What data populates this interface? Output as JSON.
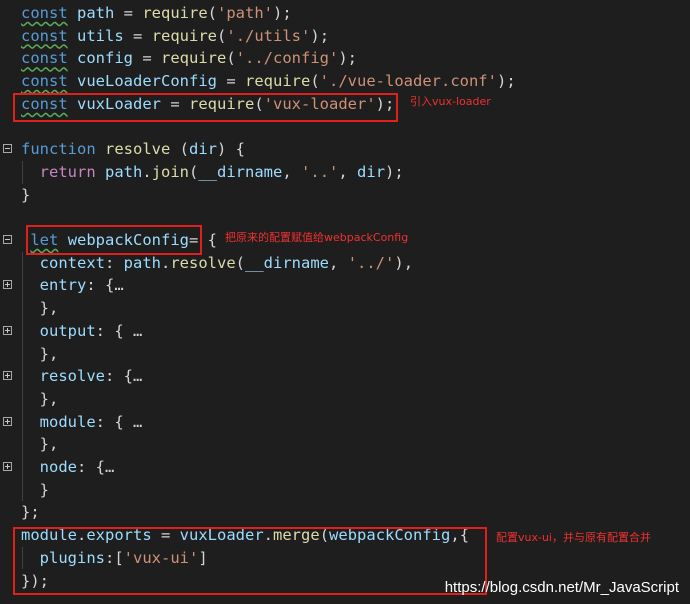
{
  "lines": [
    {
      "tokens": [
        [
          "kw",
          "const"
        ],
        [
          "punc",
          " "
        ],
        [
          "var",
          "path"
        ],
        [
          "punc",
          " = "
        ],
        [
          "fn",
          "require"
        ],
        [
          "punc",
          "("
        ],
        [
          "str",
          "'path'"
        ],
        [
          "punc",
          ");"
        ]
      ]
    },
    {
      "tokens": [
        [
          "kw",
          "const"
        ],
        [
          "punc",
          " "
        ],
        [
          "var",
          "utils"
        ],
        [
          "punc",
          " = "
        ],
        [
          "fn",
          "require"
        ],
        [
          "punc",
          "("
        ],
        [
          "str",
          "'./utils'"
        ],
        [
          "punc",
          ");"
        ]
      ]
    },
    {
      "tokens": [
        [
          "kw",
          "const"
        ],
        [
          "punc",
          " "
        ],
        [
          "var",
          "config"
        ],
        [
          "punc",
          " = "
        ],
        [
          "fn",
          "require"
        ],
        [
          "punc",
          "("
        ],
        [
          "str",
          "'../config'"
        ],
        [
          "punc",
          ");"
        ]
      ]
    },
    {
      "tokens": [
        [
          "kw",
          "const"
        ],
        [
          "punc",
          " "
        ],
        [
          "var",
          "vueLoaderConfig"
        ],
        [
          "punc",
          " = "
        ],
        [
          "fn",
          "require"
        ],
        [
          "punc",
          "("
        ],
        [
          "str",
          "'./vue-loader.conf'"
        ],
        [
          "punc",
          ");"
        ]
      ]
    },
    {
      "tokens": [
        [
          "kw",
          "const"
        ],
        [
          "punc",
          " "
        ],
        [
          "var",
          "vuxLoader"
        ],
        [
          "punc",
          " = "
        ],
        [
          "fn",
          "require"
        ],
        [
          "punc",
          "("
        ],
        [
          "str",
          "'vux-loader'"
        ],
        [
          "punc",
          ");"
        ]
      ]
    },
    {
      "tokens": []
    },
    {
      "tokens": [
        [
          "kw",
          "function"
        ],
        [
          "punc",
          " "
        ],
        [
          "fn",
          "resolve"
        ],
        [
          "punc",
          " ("
        ],
        [
          "var",
          "dir"
        ],
        [
          "punc",
          ") {"
        ]
      ]
    },
    {
      "tokens": [
        [
          "punc",
          "  "
        ],
        [
          "ctl",
          "return"
        ],
        [
          "punc",
          " "
        ],
        [
          "var",
          "path"
        ],
        [
          "punc",
          "."
        ],
        [
          "fn",
          "join"
        ],
        [
          "punc",
          "("
        ],
        [
          "var",
          "__dirname"
        ],
        [
          "punc",
          ", "
        ],
        [
          "str",
          "'..'"
        ],
        [
          "punc",
          ", "
        ],
        [
          "var",
          "dir"
        ],
        [
          "punc",
          ");"
        ]
      ]
    },
    {
      "tokens": [
        [
          "punc",
          "}"
        ]
      ]
    },
    {
      "tokens": []
    },
    {
      "tokens": [
        [
          "punc",
          " "
        ],
        [
          "kw",
          "let"
        ],
        [
          "punc",
          " "
        ],
        [
          "var",
          "webpackConfig"
        ],
        [
          "punc",
          "= {"
        ]
      ]
    },
    {
      "tokens": [
        [
          "punc",
          "  "
        ],
        [
          "var",
          "context"
        ],
        [
          "punc",
          ": "
        ],
        [
          "var",
          "path"
        ],
        [
          "punc",
          "."
        ],
        [
          "fn",
          "resolve"
        ],
        [
          "punc",
          "("
        ],
        [
          "var",
          "__dirname"
        ],
        [
          "punc",
          ", "
        ],
        [
          "str",
          "'../'"
        ],
        [
          "punc",
          "),"
        ]
      ]
    },
    {
      "tokens": [
        [
          "punc",
          "  "
        ],
        [
          "var",
          "entry"
        ],
        [
          "punc",
          ": {"
        ],
        [
          "fold-ell",
          "…"
        ]
      ]
    },
    {
      "tokens": [
        [
          "punc",
          "  },"
        ]
      ]
    },
    {
      "tokens": [
        [
          "punc",
          "  "
        ],
        [
          "var",
          "output"
        ],
        [
          "punc",
          ": {"
        ],
        [
          "fold-ell",
          " …"
        ]
      ]
    },
    {
      "tokens": [
        [
          "punc",
          "  },"
        ]
      ]
    },
    {
      "tokens": [
        [
          "punc",
          "  "
        ],
        [
          "var",
          "resolve"
        ],
        [
          "punc",
          ": {"
        ],
        [
          "fold-ell",
          "…"
        ]
      ]
    },
    {
      "tokens": [
        [
          "punc",
          "  },"
        ]
      ]
    },
    {
      "tokens": [
        [
          "punc",
          "  "
        ],
        [
          "var",
          "module"
        ],
        [
          "punc",
          ": {"
        ],
        [
          "fold-ell",
          " …"
        ]
      ]
    },
    {
      "tokens": [
        [
          "punc",
          "  },"
        ]
      ]
    },
    {
      "tokens": [
        [
          "punc",
          "  "
        ],
        [
          "var",
          "node"
        ],
        [
          "punc",
          ": {"
        ],
        [
          "fold-ell",
          "…"
        ]
      ]
    },
    {
      "tokens": [
        [
          "punc",
          "  }"
        ]
      ]
    },
    {
      "tokens": [
        [
          "punc",
          "};"
        ]
      ]
    },
    {
      "tokens": [
        [
          "var",
          "module"
        ],
        [
          "punc",
          "."
        ],
        [
          "var",
          "exports"
        ],
        [
          "punc",
          " = "
        ],
        [
          "var",
          "vuxLoader"
        ],
        [
          "punc",
          "."
        ],
        [
          "fn",
          "merge"
        ],
        [
          "punc",
          "("
        ],
        [
          "var",
          "webpackConfig"
        ],
        [
          "punc",
          ",{"
        ]
      ]
    },
    {
      "tokens": [
        [
          "punc",
          "  "
        ],
        [
          "var",
          "plugins"
        ],
        [
          "punc",
          ":["
        ],
        [
          "str",
          "'vux-ui'"
        ],
        [
          "punc",
          "]"
        ]
      ]
    },
    {
      "tokens": [
        [
          "punc",
          "});"
        ]
      ]
    }
  ],
  "annotations": {
    "import_note": "引入vux-loader",
    "assign_note": "把原来的配置赋值给webpackConfig",
    "merge_note": "配置vux-ui，并与原有配置合并"
  },
  "watermark": "https://blog.csdn.net/Mr_JavaScript",
  "colors": {
    "background": "#1e1e1e",
    "keyword": "#569cd6",
    "control_keyword": "#c586c0",
    "variable": "#9cdcfe",
    "function": "#dcdcaa",
    "string": "#ce9178",
    "highlight_box": "#e0201b"
  },
  "icons": [
    "fold-collapse-icon",
    "fold-expand-icon"
  ]
}
